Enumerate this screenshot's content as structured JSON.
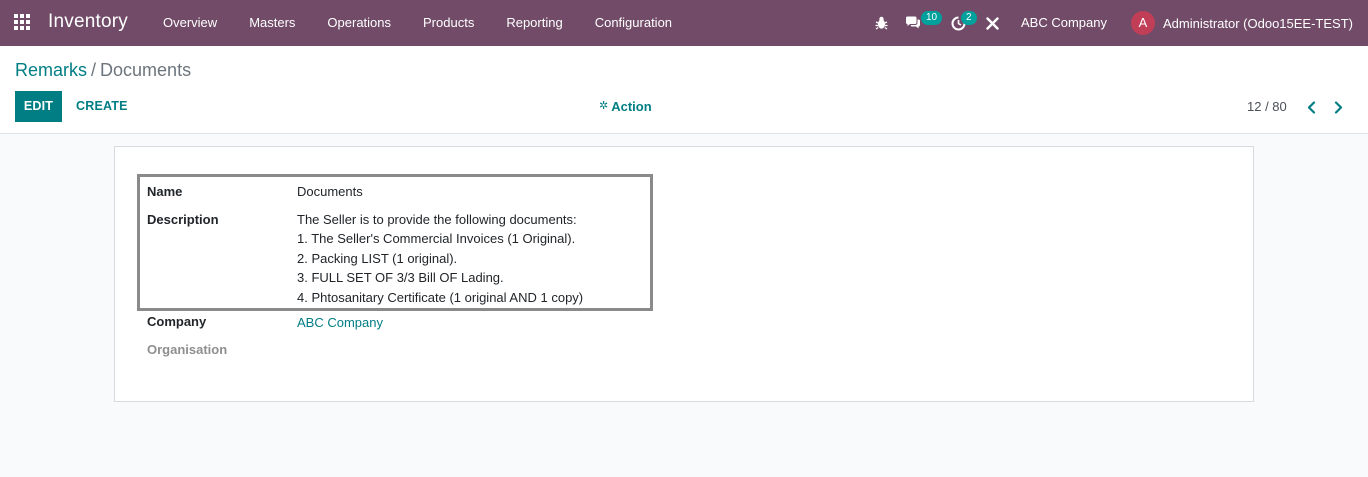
{
  "navbar": {
    "app_name": "Inventory",
    "menu": [
      "Overview",
      "Masters",
      "Operations",
      "Products",
      "Reporting",
      "Configuration"
    ],
    "messages_count": "10",
    "activities_count": "2",
    "company": "ABC Company",
    "user_initial": "A",
    "user_name": "Administrator (Odoo15EE-TEST)",
    "accent_color": "#714b67"
  },
  "control_panel": {
    "breadcrumb": {
      "parent": "Remarks",
      "separator": "/",
      "current": "Documents"
    },
    "edit_label": "EDIT",
    "create_label": "CREATE",
    "action_label": "Action",
    "pager": "12 / 80"
  },
  "form": {
    "name_label": "Name",
    "name_value": "Documents",
    "description_label": "Description",
    "description_lines": [
      "The Seller is to provide the following documents:",
      "1. The Seller's Commercial Invoices (1 Original).",
      "2. Packing LIST (1 original).",
      "3. FULL SET OF 3/3 Bill OF Lading.",
      "4. Phtosanitary Certificate (1 original AND 1 copy)"
    ],
    "company_label": "Company",
    "company_value": "ABC Company",
    "organisation_label": "Organisation"
  }
}
